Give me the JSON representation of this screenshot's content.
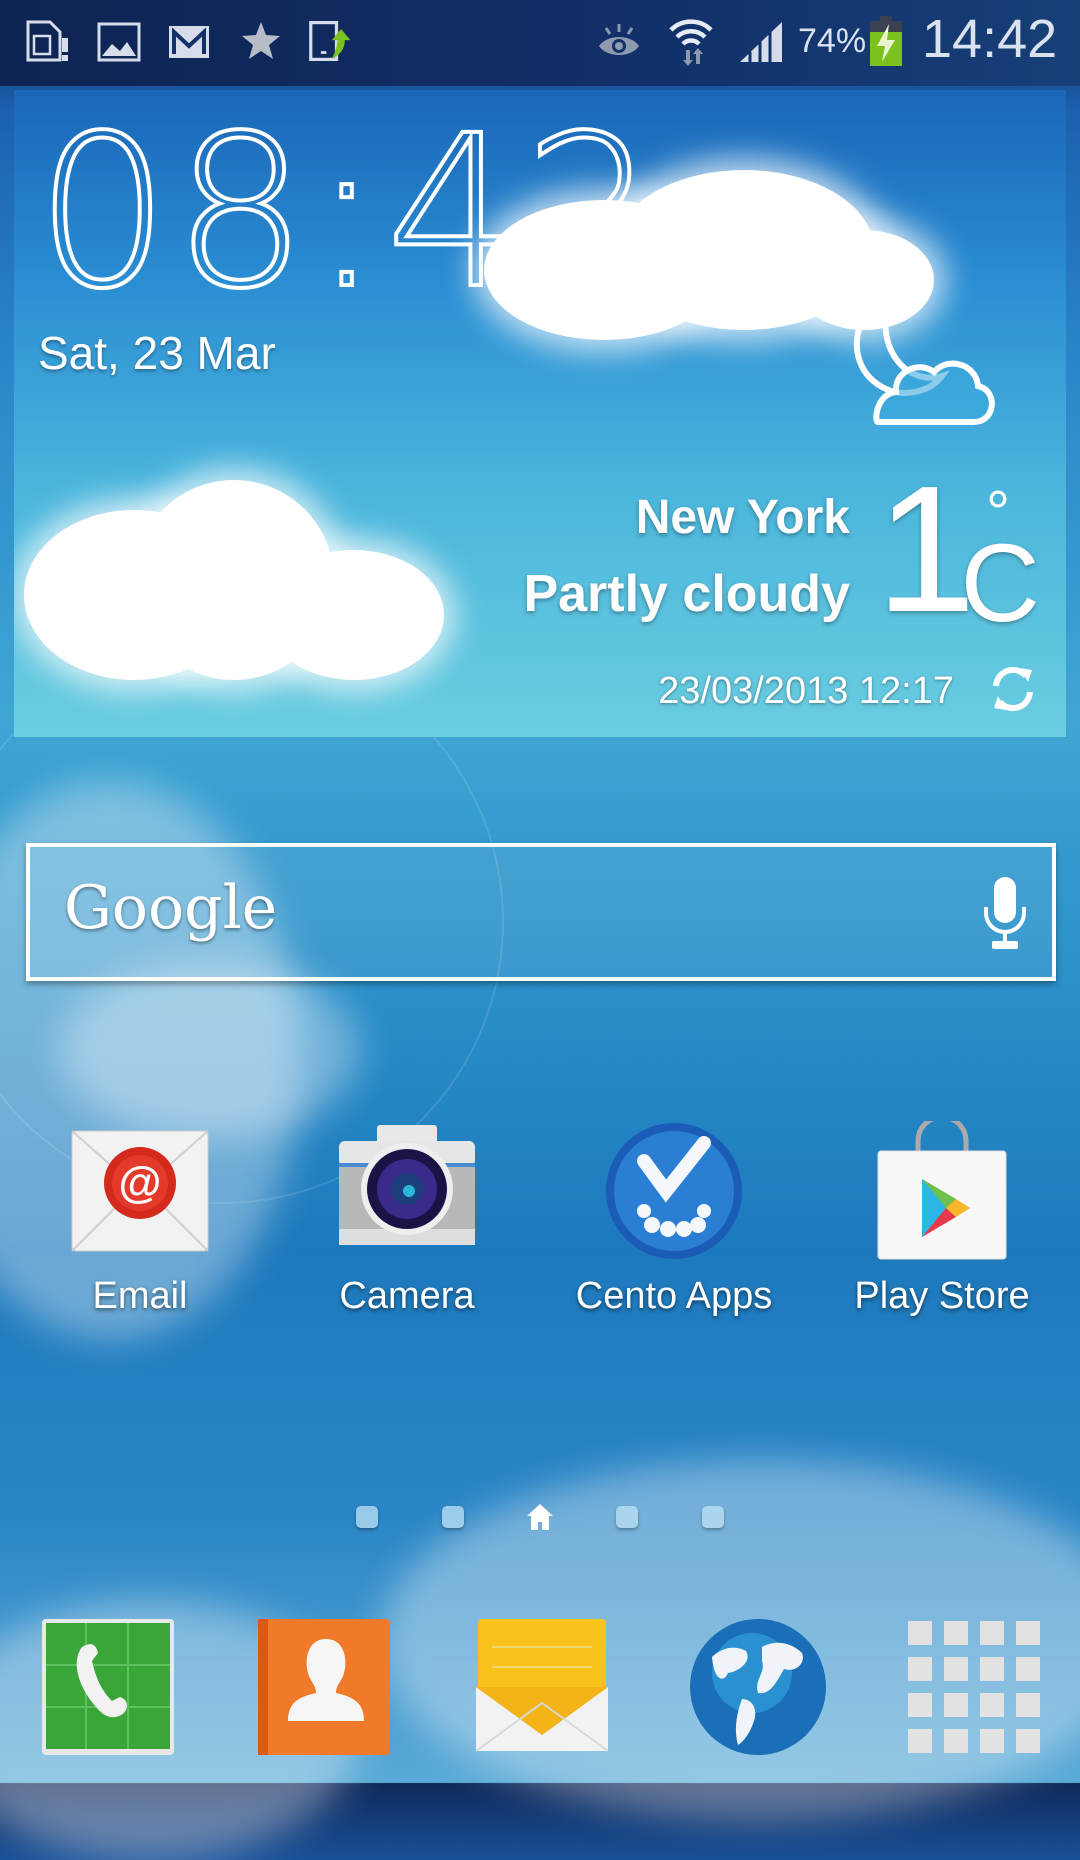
{
  "status_bar": {
    "notification_icons": [
      "sim-card-alert-icon",
      "gallery-icon",
      "gmail-icon",
      "star-icon",
      "phone-transfer-icon"
    ],
    "system_icons": [
      "smart-stay-eye-icon",
      "wifi-data-icon",
      "signal-strength-icon"
    ],
    "battery_percent": "74%",
    "battery_level": 0.74,
    "battery_charging": true,
    "time": "14:42"
  },
  "weather_widget": {
    "clock_time": "08:42",
    "date": "Sat, 23 Mar",
    "city": "New York",
    "condition": "Partly cloudy",
    "temperature": "1",
    "degree_symbol": "°",
    "unit": "C",
    "updated": "23/03/2013 12:17",
    "condition_icon": "moon-cloud-icon"
  },
  "search_bar": {
    "logo_text": "Google",
    "voice_icon": "microphone-icon"
  },
  "apps": [
    {
      "label": "Email",
      "icon": "email-icon"
    },
    {
      "label": "Camera",
      "icon": "camera-icon"
    },
    {
      "label": "Cento Apps",
      "icon": "cento-apps-icon"
    },
    {
      "label": "Play Store",
      "icon": "play-store-icon"
    }
  ],
  "page_indicator": {
    "pages": 5,
    "current": 3,
    "current_icon": "home-icon"
  },
  "dock": [
    {
      "name": "Phone",
      "icon": "phone-icon"
    },
    {
      "name": "Contacts",
      "icon": "contacts-icon"
    },
    {
      "name": "Messages",
      "icon": "messages-icon"
    },
    {
      "name": "Internet",
      "icon": "internet-globe-icon"
    },
    {
      "name": "Apps",
      "icon": "app-drawer-icon"
    }
  ],
  "colors": {
    "status_bar_bg": "#0d2452",
    "battery_green": "#7cc21e",
    "wallpaper_blue": "#2a86c9"
  }
}
